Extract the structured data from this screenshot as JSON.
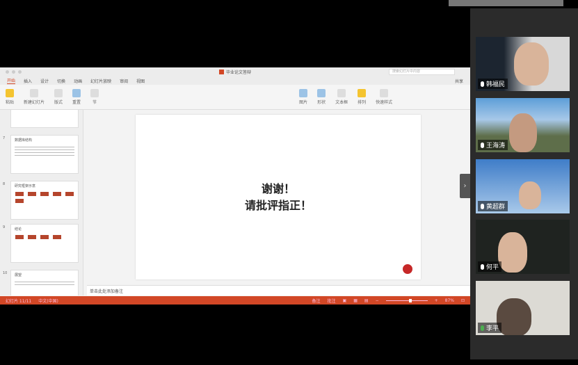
{
  "window": {
    "title": "毕业论文答辩",
    "search_placeholder": "搜索幻灯片中内容",
    "share": "共享"
  },
  "tabs": [
    "开始",
    "插入",
    "设计",
    "切换",
    "动画",
    "幻灯片放映",
    "审阅",
    "视图"
  ],
  "ribbon": [
    "粘贴",
    "新建幻灯片",
    "版式",
    "重置",
    "节",
    "图片",
    "形状",
    "文本框",
    "排列",
    "快速样式"
  ],
  "thumbnails": [
    {
      "number": "7",
      "title": "数据库结构"
    },
    {
      "number": "8",
      "title": "研究框架示意"
    },
    {
      "number": "9",
      "title": "结论"
    },
    {
      "number": "10",
      "title": "展望"
    }
  ],
  "slide": {
    "line1": "谢谢！",
    "line2": "请批评指正！"
  },
  "notes_placeholder": "单击此处添加备注",
  "status": {
    "slide": "幻灯片 11/11",
    "language": "中文(中国)",
    "notes": "备注",
    "comments": "批注",
    "zoom": "87%",
    "zoom_fraction": 0.55
  },
  "participants": [
    {
      "name": "韩福民",
      "mic": "white"
    },
    {
      "name": "王海涛",
      "mic": "white"
    },
    {
      "name": "黄超群",
      "mic": "white"
    },
    {
      "name": "何平",
      "mic": "white"
    },
    {
      "name": "李平",
      "mic": "green"
    }
  ]
}
